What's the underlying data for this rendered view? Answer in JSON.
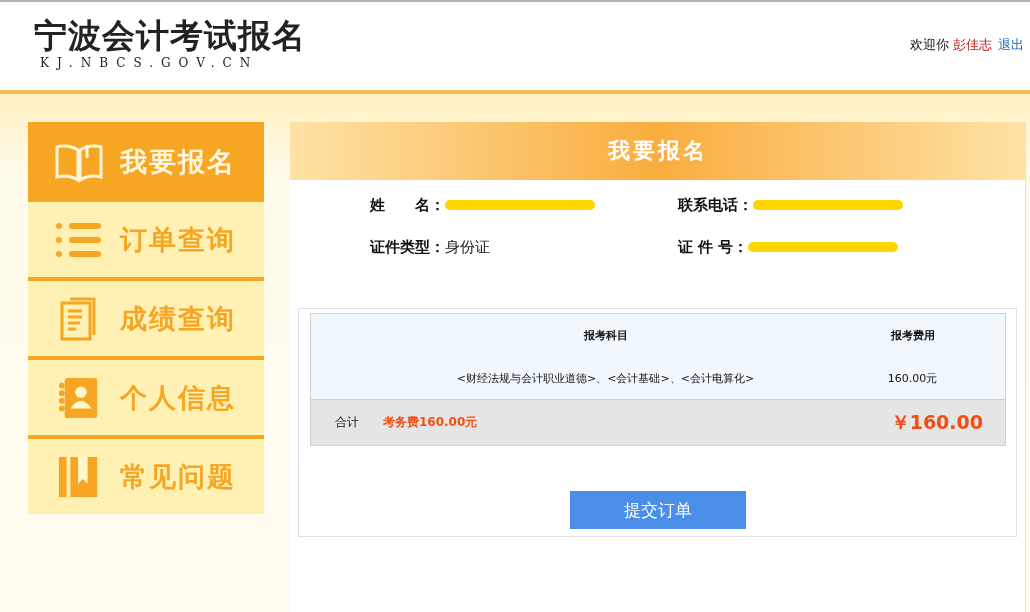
{
  "header": {
    "logo_title": "宁波会计考试报名",
    "logo_subtitle": "KJ.NBCS.GOV.CN",
    "welcome": "欢迎你",
    "user_name": "彭佳志",
    "logout": "退出"
  },
  "sidebar": {
    "items": [
      {
        "label": "我要报名",
        "selected": true
      },
      {
        "label": "订单查询",
        "selected": false
      },
      {
        "label": "成绩查询",
        "selected": false
      },
      {
        "label": "个人信息",
        "selected": false
      },
      {
        "label": "常见问题",
        "selected": false
      }
    ]
  },
  "panel": {
    "title": "我要报名",
    "fields": [
      {
        "label": "姓　　名：",
        "redacted": true
      },
      {
        "label": "联系电话：",
        "redacted": true
      },
      {
        "label": "证件类型：",
        "value": "身份证",
        "redacted": false
      },
      {
        "label": "证 件 号：",
        "redacted": true
      }
    ],
    "table": {
      "columns": [
        "报考科目",
        "报考费用"
      ],
      "rows": [
        {
          "subjects": "<财经法规与会计职业道德>、<会计基础>、<会计电算化>",
          "fee": "160.00元"
        }
      ],
      "total_label": "合计",
      "total_detail": "考务费160.00元",
      "total_amount": "￥160.00"
    },
    "submit_button": "提交订单"
  }
}
